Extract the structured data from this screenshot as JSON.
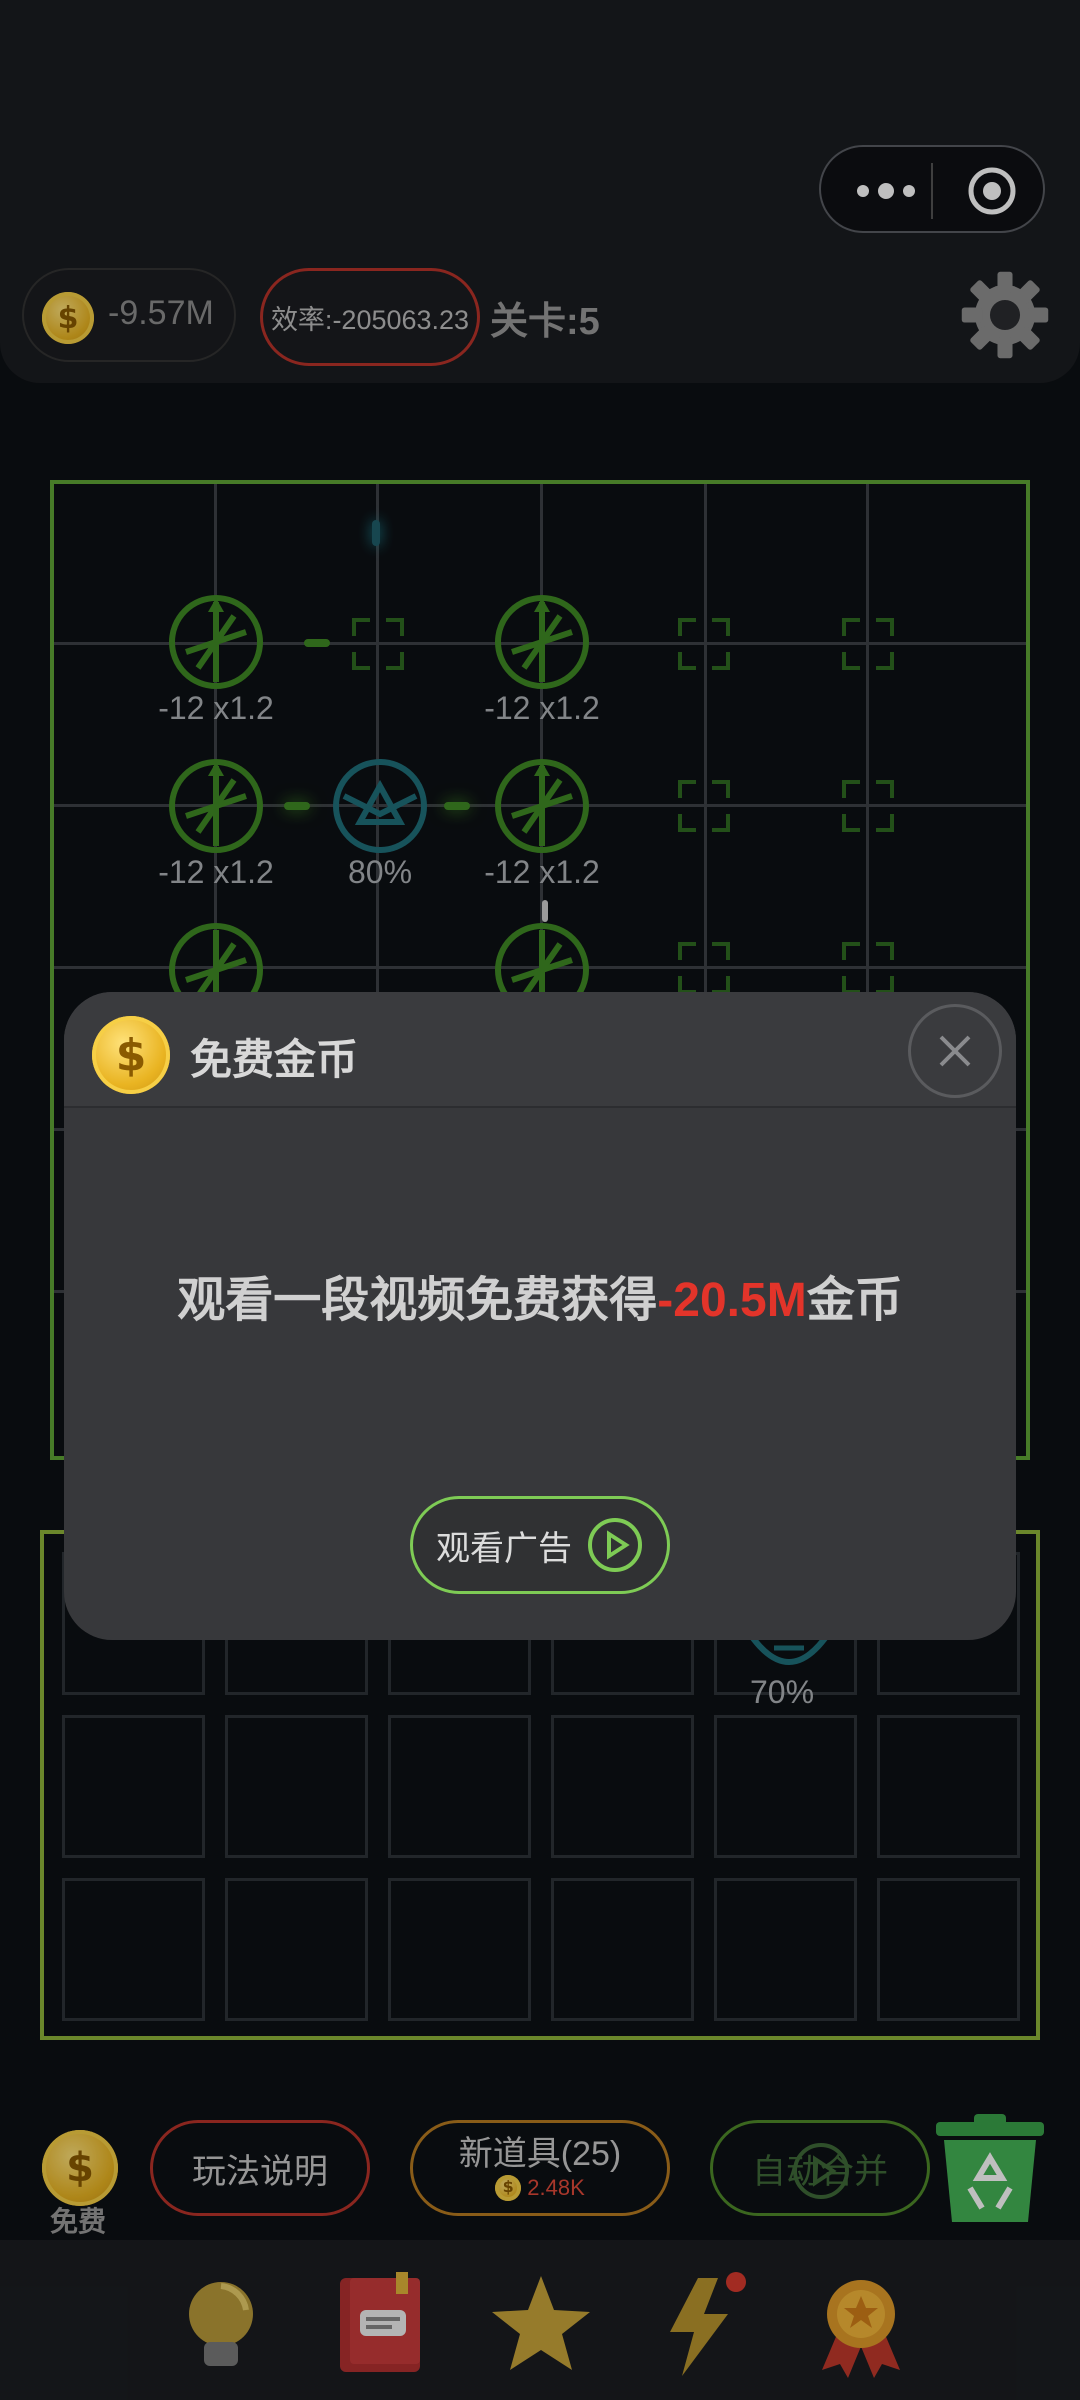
{
  "header": {
    "coins": "-9.57M",
    "efficiency": "效率:-205063.23",
    "level": "关卡:5"
  },
  "board": {
    "turret_labels": [
      "-12 x1.2",
      "-12 x1.2",
      "-12 x1.2",
      "80%",
      "-12 x1.2"
    ]
  },
  "inventory": {
    "visible_label": "70%"
  },
  "bottom": {
    "free_label": "免费",
    "help_label": "玩法说明",
    "new_item_label": "新道具(25)",
    "new_item_cost": "2.48K",
    "auto_merge_label": "自动合并"
  },
  "tabs": [
    "lightbulb-icon",
    "book-icon",
    "star-icon",
    "lightning-icon",
    "medal-icon"
  ],
  "modal": {
    "title": "免费金币",
    "message_prefix": "观看一段视频免费获得",
    "message_amount": "-20.5M",
    "message_suffix": "金币",
    "watch_button": "观看广告"
  },
  "colors": {
    "accent_green": "#5fa436",
    "danger_red": "#e3342a",
    "gold": "#e9b422"
  }
}
